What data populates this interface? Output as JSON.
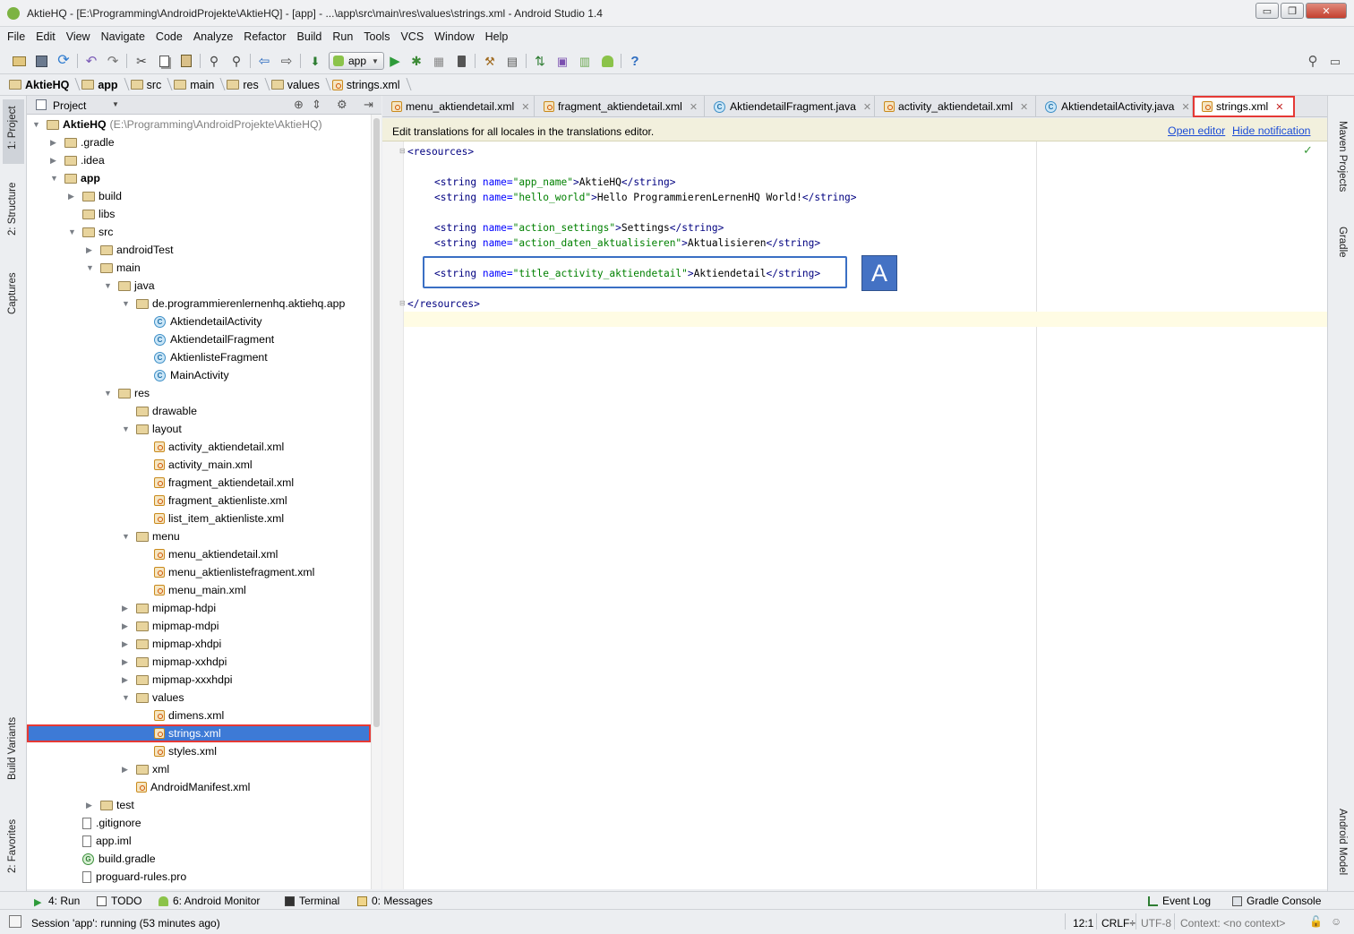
{
  "window": {
    "title": "AktieHQ - [E:\\Programming\\AndroidProjekte\\AktieHQ] - [app] - ...\\app\\src\\main\\res\\values\\strings.xml - Android Studio 1.4",
    "buttons": [
      "▭",
      "❐",
      "✕"
    ]
  },
  "menu": [
    "File",
    "Edit",
    "View",
    "Navigate",
    "Code",
    "Analyze",
    "Refactor",
    "Build",
    "Run",
    "Tools",
    "VCS",
    "Window",
    "Help"
  ],
  "toolbar": {
    "run_config": "app",
    "icons": [
      "open-folder-icon",
      "save-icon",
      "sync-icon",
      "undo-icon",
      "redo-icon",
      "cut-icon",
      "copy-icon",
      "paste-icon",
      "find-icon",
      "replace-icon",
      "back-icon",
      "forward-icon",
      "make-project-icon",
      "run-config-select",
      "run-icon",
      "debug-icon",
      "attach-debugger-icon",
      "stop-icon",
      "sdk-manager-icon",
      "avd-manager-icon",
      "sync-gradle-icon",
      "device-monitor-icon",
      "android-icon",
      "android-monitor-icon",
      "help-icon",
      "search-everywhere-icon"
    ]
  },
  "breadcrumbs": [
    "AktieHQ",
    "app",
    "src",
    "main",
    "res",
    "values",
    "strings.xml"
  ],
  "left_strip": {
    "project": "1: Project",
    "structure": "2: Structure",
    "captures": "Captures",
    "build_variants": "Build Variants",
    "favorites": "2: Favorites"
  },
  "right_strip": {
    "maven": "Maven Projects",
    "gradle": "Gradle",
    "android_model": "Android Model"
  },
  "project_panel": {
    "view_label": "Project",
    "root_label": "AktieHQ",
    "root_path": "(E:\\Programming\\AndroidProjekte\\AktieHQ)",
    "tree": [
      {
        "label": ".gradle",
        "depth": 1,
        "icon": "folder",
        "arrow": "▶"
      },
      {
        "label": ".idea",
        "depth": 1,
        "icon": "folder",
        "arrow": "▶"
      },
      {
        "label": "app",
        "depth": 1,
        "icon": "folder",
        "arrow": "▼",
        "bold": true
      },
      {
        "label": "build",
        "depth": 2,
        "icon": "folder",
        "arrow": "▶"
      },
      {
        "label": "libs",
        "depth": 2,
        "icon": "folder",
        "arrow": ""
      },
      {
        "label": "src",
        "depth": 2,
        "icon": "folder",
        "arrow": "▼"
      },
      {
        "label": "androidTest",
        "depth": 3,
        "icon": "folder",
        "arrow": "▶"
      },
      {
        "label": "main",
        "depth": 3,
        "icon": "folder",
        "arrow": "▼"
      },
      {
        "label": "java",
        "depth": 4,
        "icon": "folder",
        "arrow": "▼"
      },
      {
        "label": "de.programmierenlernenhq.aktiehq.app",
        "depth": 5,
        "icon": "folder",
        "arrow": "▼"
      },
      {
        "label": "AktiendetailActivity",
        "depth": 6,
        "icon": "class",
        "arrow": ""
      },
      {
        "label": "AktiendetailFragment",
        "depth": 6,
        "icon": "class",
        "arrow": ""
      },
      {
        "label": "AktienlisteFragment",
        "depth": 6,
        "icon": "class",
        "arrow": ""
      },
      {
        "label": "MainActivity",
        "depth": 6,
        "icon": "class",
        "arrow": ""
      },
      {
        "label": "res",
        "depth": 4,
        "icon": "folder",
        "arrow": "▼"
      },
      {
        "label": "drawable",
        "depth": 5,
        "icon": "folder",
        "arrow": ""
      },
      {
        "label": "layout",
        "depth": 5,
        "icon": "folder",
        "arrow": "▼"
      },
      {
        "label": "activity_aktiendetail.xml",
        "depth": 6,
        "icon": "xml",
        "arrow": ""
      },
      {
        "label": "activity_main.xml",
        "depth": 6,
        "icon": "xml",
        "arrow": ""
      },
      {
        "label": "fragment_aktiendetail.xml",
        "depth": 6,
        "icon": "xml",
        "arrow": ""
      },
      {
        "label": "fragment_aktienliste.xml",
        "depth": 6,
        "icon": "xml",
        "arrow": ""
      },
      {
        "label": "list_item_aktienliste.xml",
        "depth": 6,
        "icon": "xml",
        "arrow": ""
      },
      {
        "label": "menu",
        "depth": 5,
        "icon": "folder",
        "arrow": "▼"
      },
      {
        "label": "menu_aktiendetail.xml",
        "depth": 6,
        "icon": "xml",
        "arrow": ""
      },
      {
        "label": "menu_aktienlistefragment.xml",
        "depth": 6,
        "icon": "xml",
        "arrow": ""
      },
      {
        "label": "menu_main.xml",
        "depth": 6,
        "icon": "xml",
        "arrow": ""
      },
      {
        "label": "mipmap-hdpi",
        "depth": 5,
        "icon": "folder",
        "arrow": "▶"
      },
      {
        "label": "mipmap-mdpi",
        "depth": 5,
        "icon": "folder",
        "arrow": "▶"
      },
      {
        "label": "mipmap-xhdpi",
        "depth": 5,
        "icon": "folder",
        "arrow": "▶"
      },
      {
        "label": "mipmap-xxhdpi",
        "depth": 5,
        "icon": "folder",
        "arrow": "▶"
      },
      {
        "label": "mipmap-xxxhdpi",
        "depth": 5,
        "icon": "folder",
        "arrow": "▶"
      },
      {
        "label": "values",
        "depth": 5,
        "icon": "folder",
        "arrow": "▼"
      },
      {
        "label": "dimens.xml",
        "depth": 6,
        "icon": "xml",
        "arrow": ""
      },
      {
        "label": "strings.xml",
        "depth": 6,
        "icon": "xml",
        "arrow": "",
        "selected": true
      },
      {
        "label": "styles.xml",
        "depth": 6,
        "icon": "xml",
        "arrow": ""
      },
      {
        "label": "xml",
        "depth": 5,
        "icon": "folder",
        "arrow": "▶"
      },
      {
        "label": "AndroidManifest.xml",
        "depth": 5,
        "icon": "xml",
        "arrow": ""
      },
      {
        "label": "test",
        "depth": 3,
        "icon": "folder",
        "arrow": "▶"
      },
      {
        "label": ".gitignore",
        "depth": 2,
        "icon": "file",
        "arrow": ""
      },
      {
        "label": "app.iml",
        "depth": 2,
        "icon": "file",
        "arrow": ""
      },
      {
        "label": "build.gradle",
        "depth": 2,
        "icon": "gradle",
        "arrow": ""
      },
      {
        "label": "proguard-rules.pro",
        "depth": 2,
        "icon": "file",
        "arrow": ""
      }
    ]
  },
  "editor_tabs": [
    {
      "label": "menu_aktiendetail.xml",
      "icon": "xml"
    },
    {
      "label": "fragment_aktiendetail.xml",
      "icon": "xml"
    },
    {
      "label": "AktiendetailFragment.java",
      "icon": "class"
    },
    {
      "label": "activity_aktiendetail.xml",
      "icon": "xml"
    },
    {
      "label": "AktiendetailActivity.java",
      "icon": "class"
    },
    {
      "label": "strings.xml",
      "icon": "xml",
      "active": true
    }
  ],
  "notification": {
    "message": "Edit translations for all locales in the translations editor.",
    "open_editor": "Open editor",
    "hide": "Hide notification"
  },
  "code": {
    "open_tag": "<resources>",
    "close_tag": "</resources>",
    "strings": [
      {
        "name": "app_name",
        "value": "AktieHQ"
      },
      {
        "name": "hello_world",
        "value": "Hello ProgrammierenLernenHQ World!"
      },
      {
        "name": "action_settings",
        "value": "Settings"
      },
      {
        "name": "action_daten_aktualisieren",
        "value": "Aktualisieren"
      },
      {
        "name": "title_activity_aktiendetail",
        "value": "Aktiendetail"
      }
    ]
  },
  "annotation_badge": "A",
  "bottom_tools": {
    "run": "4: Run",
    "todo": "TODO",
    "android_monitor": "6: Android Monitor",
    "terminal": "Terminal",
    "messages": "0: Messages",
    "event_log": "Event Log",
    "gradle_console": "Gradle Console"
  },
  "status": {
    "session": "Session 'app': running (53 minutes ago)",
    "position": "12:1",
    "line_sep": "CRLF÷",
    "encoding": "UTF-8",
    "context": "Context: <no context>"
  },
  "colors": {
    "selection": "#3d7ad6",
    "highlight_border": "#e53935",
    "badge": "#4472c4",
    "tag": "#000080",
    "attr": "#0000ff",
    "value": "#008000"
  }
}
